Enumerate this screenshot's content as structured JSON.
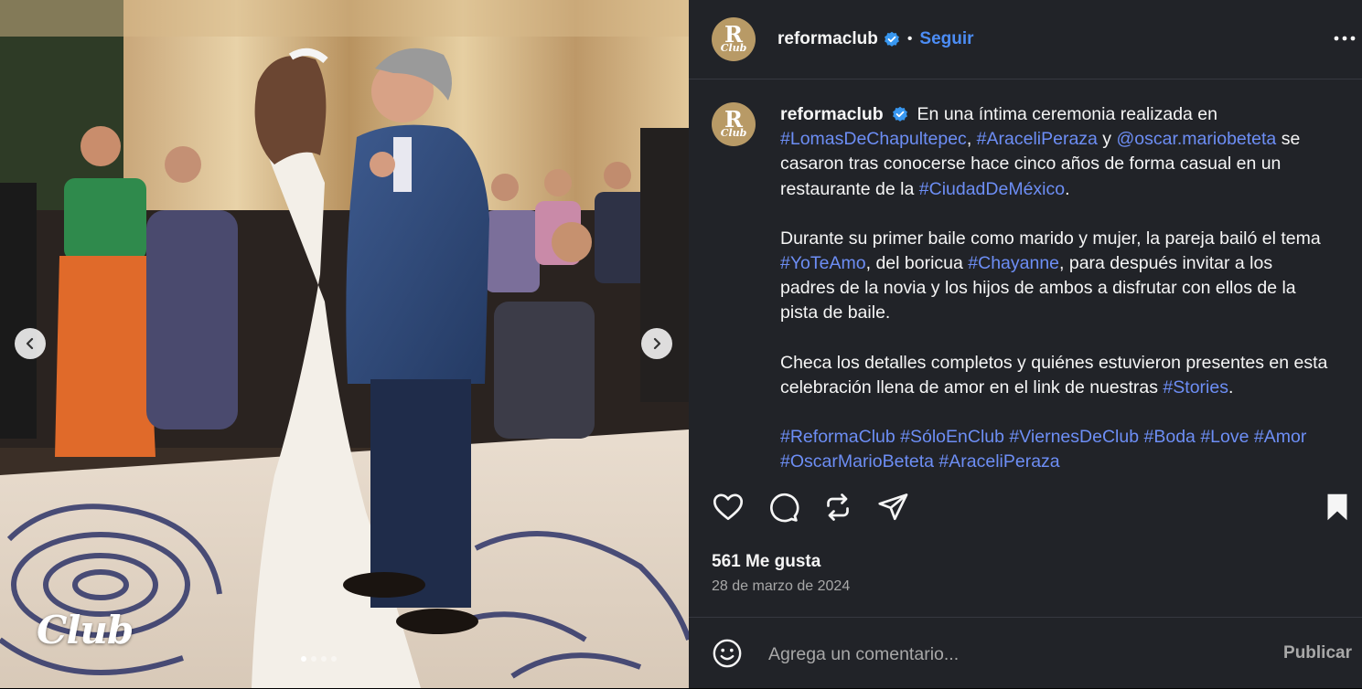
{
  "photo": {
    "watermark": "Club",
    "carousel_count": 4,
    "carousel_active": 1
  },
  "header": {
    "avatar_letter": "R",
    "avatar_sub": "Club",
    "username": "reformaclub",
    "separator": "•",
    "follow_label": "Seguir",
    "more_icon": "more-dots-icon"
  },
  "caption": {
    "username": "reformaclub",
    "p1": [
      {
        "t": "En una íntima ceremonia realizada en ",
        "link": false
      },
      {
        "t": "#LomasDeChapultepec",
        "link": true
      },
      {
        "t": ", ",
        "link": false
      },
      {
        "t": "#AraceliPeraza",
        "link": true
      },
      {
        "t": " y ",
        "link": false
      },
      {
        "t": "@oscar.mariobeteta",
        "link": true
      },
      {
        "t": " se casaron tras conocerse hace cinco años de forma casual en un restaurante de la ",
        "link": false
      },
      {
        "t": "#CiudadDeMéxico",
        "link": true
      },
      {
        "t": ".",
        "link": false
      }
    ],
    "p2": [
      {
        "t": "Durante su primer baile como marido y mujer, la pareja bailó el tema ",
        "link": false
      },
      {
        "t": "#YoTeAmo",
        "link": true
      },
      {
        "t": ", del boricua ",
        "link": false
      },
      {
        "t": "#Chayanne",
        "link": true
      },
      {
        "t": ", para después invitar a los padres de la novia y los hijos de ambos a disfrutar con ellos de la pista de baile.",
        "link": false
      }
    ],
    "p3": [
      {
        "t": "Checa los detalles completos y quiénes estuvieron presentes en esta celebración llena de amor en el link de nuestras ",
        "link": false
      },
      {
        "t": "#Stories",
        "link": true
      },
      {
        "t": ".",
        "link": false
      }
    ],
    "p4": [
      {
        "t": "#ReformaClub",
        "link": true
      },
      {
        "t": " ",
        "link": false
      },
      {
        "t": "#SóloEnClub",
        "link": true
      },
      {
        "t": " ",
        "link": false
      },
      {
        "t": "#ViernesDeClub",
        "link": true
      },
      {
        "t": " ",
        "link": false
      },
      {
        "t": "#Boda",
        "link": true
      },
      {
        "t": " ",
        "link": false
      },
      {
        "t": "#Love",
        "link": true
      },
      {
        "t": " ",
        "link": false
      },
      {
        "t": "#Amor",
        "link": true
      },
      {
        "t": " ",
        "link": false
      },
      {
        "t": "#OscarMarioBeteta",
        "link": true
      },
      {
        "t": " ",
        "link": false
      },
      {
        "t": "#AraceliPeraza",
        "link": true
      }
    ]
  },
  "actions": {
    "icons": [
      "heart-icon",
      "comment-icon",
      "repost-icon",
      "share-icon",
      "bookmark-icon"
    ]
  },
  "likes": "561 Me gusta",
  "date": "28 de marzo de 2024",
  "comment": {
    "placeholder": "Agrega un comentario...",
    "publish_label": "Publicar"
  },
  "colors": {
    "panel_bg": "#212328",
    "link": "#6d8ef5",
    "follow": "#4c8df6",
    "verified": "#3897f0",
    "avatar_bg": "#b89a66"
  }
}
